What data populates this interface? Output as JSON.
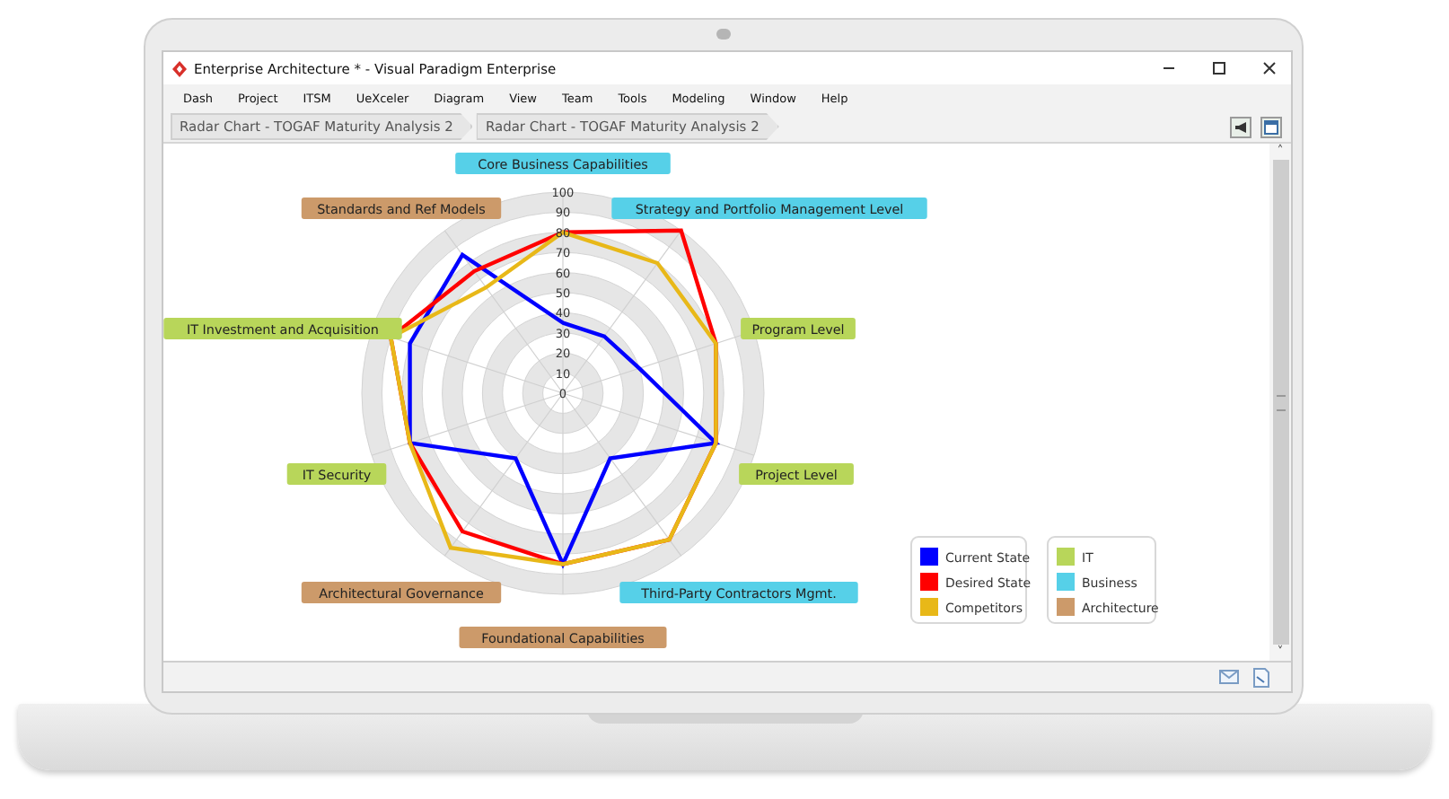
{
  "window": {
    "title": "Enterprise Architecture * - Visual Paradigm Enterprise"
  },
  "menu": [
    "Dash",
    "Project",
    "ITSM",
    "UeXceler",
    "Diagram",
    "View",
    "Team",
    "Tools",
    "Modeling",
    "Window",
    "Help"
  ],
  "breadcrumb": [
    "Radar Chart - TOGAF Maturity Analysis 2",
    "Radar Chart - TOGAF Maturity Analysis 2"
  ],
  "chart": {
    "axis_labels": [
      {
        "color": "#56d0e8"
      },
      {
        "color": "#56d0e8"
      },
      {
        "color": "#b8d65a"
      },
      {
        "color": "#b8d65a"
      },
      {
        "color": "#56d0e8"
      },
      {
        "color": "#cc9a6a"
      },
      {
        "color": "#cc9a6a"
      },
      {
        "color": "#b8d65a"
      },
      {
        "color": "#b8d65a"
      },
      {
        "color": "#cc9a6a"
      }
    ],
    "chart_data": {
      "type": "radar",
      "legend": "lower right",
      "categories": [
        "Core Business Capabilities",
        "Strategy and Portfolio Management Level",
        "Program Level",
        "Project Level",
        "Third-Party Contractors Mgmt.",
        "Foundational Capabilities",
        "Architectural Governance",
        "IT Security",
        "IT Investment and Acquisition",
        "Standards and Ref Models"
      ],
      "ylim": [
        0,
        100
      ],
      "yticks": [
        0,
        10,
        20,
        30,
        40,
        50,
        60,
        70,
        80,
        90,
        100
      ],
      "series": [
        {
          "name": "Current State",
          "color": "#0000ff",
          "values": [
            35,
            35,
            40,
            80,
            40,
            85,
            40,
            80,
            80,
            85
          ]
        },
        {
          "name": "Desired State",
          "color": "#ff0000",
          "values": [
            80,
            100,
            80,
            80,
            90,
            85,
            85,
            80,
            90,
            75
          ]
        },
        {
          "name": "Competitors",
          "color": "#e8b818",
          "values": [
            80,
            80,
            80,
            80,
            90,
            85,
            95,
            80,
            90,
            65
          ]
        }
      ]
    },
    "group_legend": [
      {
        "label": "IT",
        "color": "#b8d65a"
      },
      {
        "label": "Business",
        "color": "#56d0e8"
      },
      {
        "label": "Architecture",
        "color": "#cc9a6a"
      }
    ]
  },
  "scrollbar": {
    "up": "˄",
    "down": "˅"
  }
}
